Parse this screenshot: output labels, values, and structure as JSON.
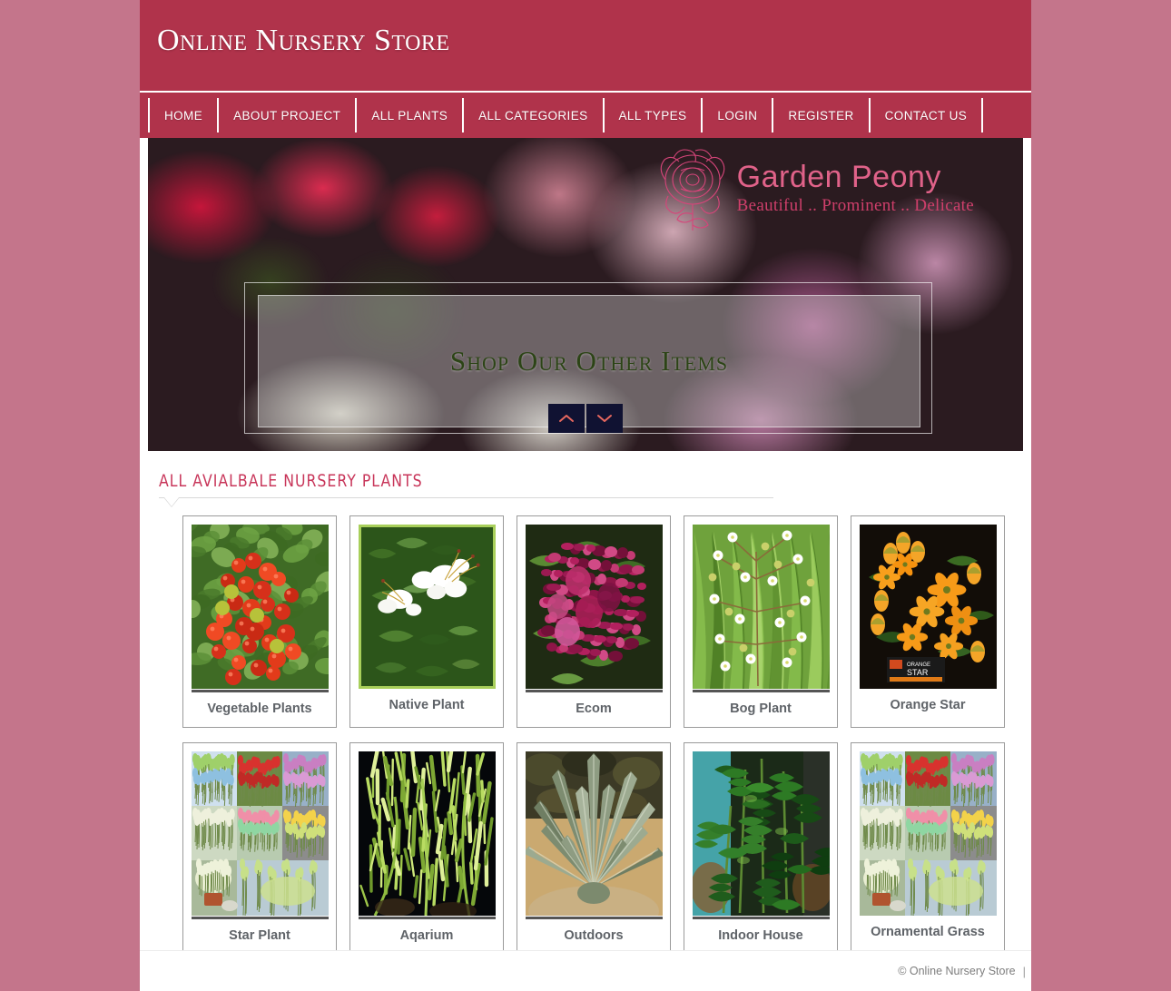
{
  "site": {
    "title": "Online Nursery Store",
    "background_color": "#c4758b",
    "brand_color": "#b0334b"
  },
  "nav": {
    "items": [
      {
        "label": "Home",
        "name": "home"
      },
      {
        "label": "About Project",
        "name": "about-project"
      },
      {
        "label": "All Plants",
        "name": "all-plants"
      },
      {
        "label": "All Categories",
        "name": "all-categories"
      },
      {
        "label": "All Types",
        "name": "all-types"
      },
      {
        "label": "Login",
        "name": "login"
      },
      {
        "label": "Register",
        "name": "register"
      },
      {
        "label": "Contact Us",
        "name": "contact-us"
      }
    ]
  },
  "banner": {
    "logo_title": "Garden Peony",
    "logo_tagline": "Beautiful .. Prominent .. Delicate",
    "logo_color": "#e06289",
    "tagline_color": "#cf3f6b",
    "caption": "Shop Our Other Items",
    "caption_color": "#2c4416",
    "prev_icon": "chevron-up-icon",
    "next_icon": "chevron-down-icon",
    "control_color": "#101232",
    "chevron_color": "#e8685f"
  },
  "section": {
    "heading": "All Avialbale Nursery Plants",
    "heading_color": "#c8365a"
  },
  "products": [
    {
      "label": "Vegetable Plants",
      "thumb": "tomato-plant-thumb",
      "framed": false,
      "rule": true
    },
    {
      "label": "Native Plant",
      "thumb": "white-azalea-thumb",
      "framed": true,
      "rule": false
    },
    {
      "label": "Ecom",
      "thumb": "magenta-flower-thumb",
      "framed": false,
      "rule": true
    },
    {
      "label": "Bog Plant",
      "thumb": "bog-greens-thumb",
      "framed": false,
      "rule": true
    },
    {
      "label": "Orange Star",
      "thumb": "orange-star-thumb",
      "framed": false,
      "rule": false
    },
    {
      "label": "Star Plant",
      "thumb": "grass-collage-thumb",
      "framed": false,
      "rule": true
    },
    {
      "label": "Aqarium",
      "thumb": "aquarium-plant-thumb",
      "framed": false,
      "rule": true
    },
    {
      "label": "Outdoors",
      "thumb": "agave-thumb",
      "framed": false,
      "rule": true
    },
    {
      "label": "Indoor House",
      "thumb": "zz-plant-thumb",
      "framed": false,
      "rule": true
    },
    {
      "label": "Ornamental Grass",
      "thumb": "grass-collage-thumb",
      "framed": false,
      "rule": false
    }
  ],
  "footer": {
    "copyright": "© Online Nursery Store",
    "separator": "|"
  }
}
